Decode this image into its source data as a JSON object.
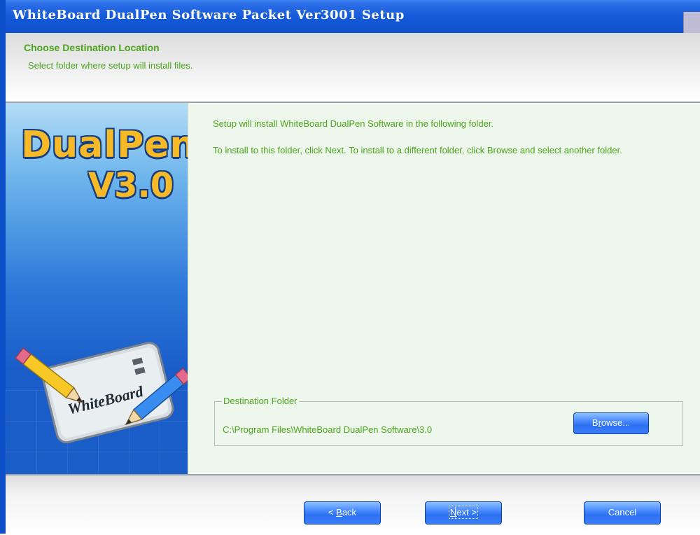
{
  "window": {
    "title": "WhiteBoard DualPen Software Packet Ver3001 Setup"
  },
  "header": {
    "title": "Choose Destination Location",
    "subtitle": "Select folder where setup will install files."
  },
  "sidebar": {
    "brand_line1": "DualPen",
    "brand_line2": "V3.0",
    "logo_text": "WhiteBoard"
  },
  "content": {
    "intro": "Setup will install WhiteBoard DualPen Software in the following folder.",
    "instructions": "To install to this folder, click Next. To install to a different folder, click Browse and select another folder.",
    "destination": {
      "legend": "Destination Folder",
      "path": "C:\\Program Files\\WhiteBoard DualPen Software\\3.0",
      "browse_pre": "B",
      "browse_mnemonic": "r",
      "browse_post": "owse..."
    }
  },
  "footer": {
    "back_pre": "< ",
    "back_mnemonic": "B",
    "back_post": "ack",
    "next_mnemonic": "N",
    "next_post": "ext >",
    "cancel": "Cancel"
  },
  "colors": {
    "accent_green": "#4aa51c",
    "title_blue": "#0f4fcc",
    "button_blue": "#2c6ff2"
  }
}
